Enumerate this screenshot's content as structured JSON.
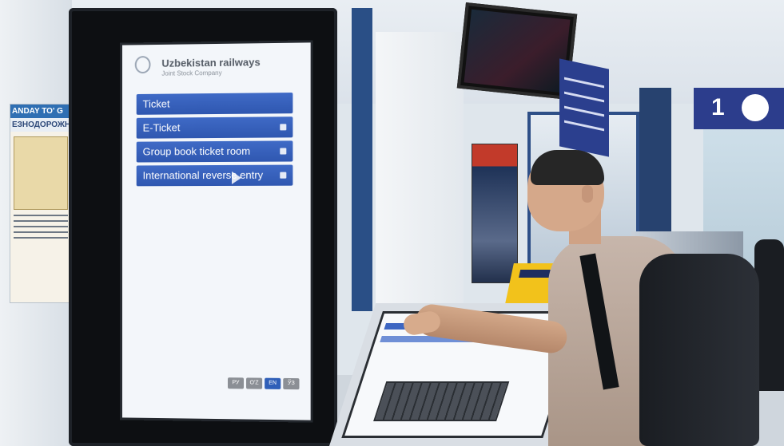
{
  "kiosk": {
    "company_name": "Uzbekistan railways",
    "company_type": "Joint Stock Company",
    "menu": [
      {
        "label": "Ticket"
      },
      {
        "label": "E-Ticket"
      },
      {
        "label": "Group book ticket room"
      },
      {
        "label": "International reverse entry"
      }
    ],
    "languages": [
      {
        "label": "РУ",
        "active": false
      },
      {
        "label": "O'Z",
        "active": false
      },
      {
        "label": "EN",
        "active": true
      },
      {
        "label": "ЎЗ",
        "active": false
      }
    ]
  },
  "signage": {
    "left_poster_header": "ANDAY TO' G",
    "left_poster_sub": "ЕЗНОДОРОЖНЬ",
    "window_number": "1"
  },
  "colors": {
    "accent_blue": "#2f57b0",
    "kiosk_frame": "#0d0f12",
    "sign_blue": "#2c3d8c"
  }
}
